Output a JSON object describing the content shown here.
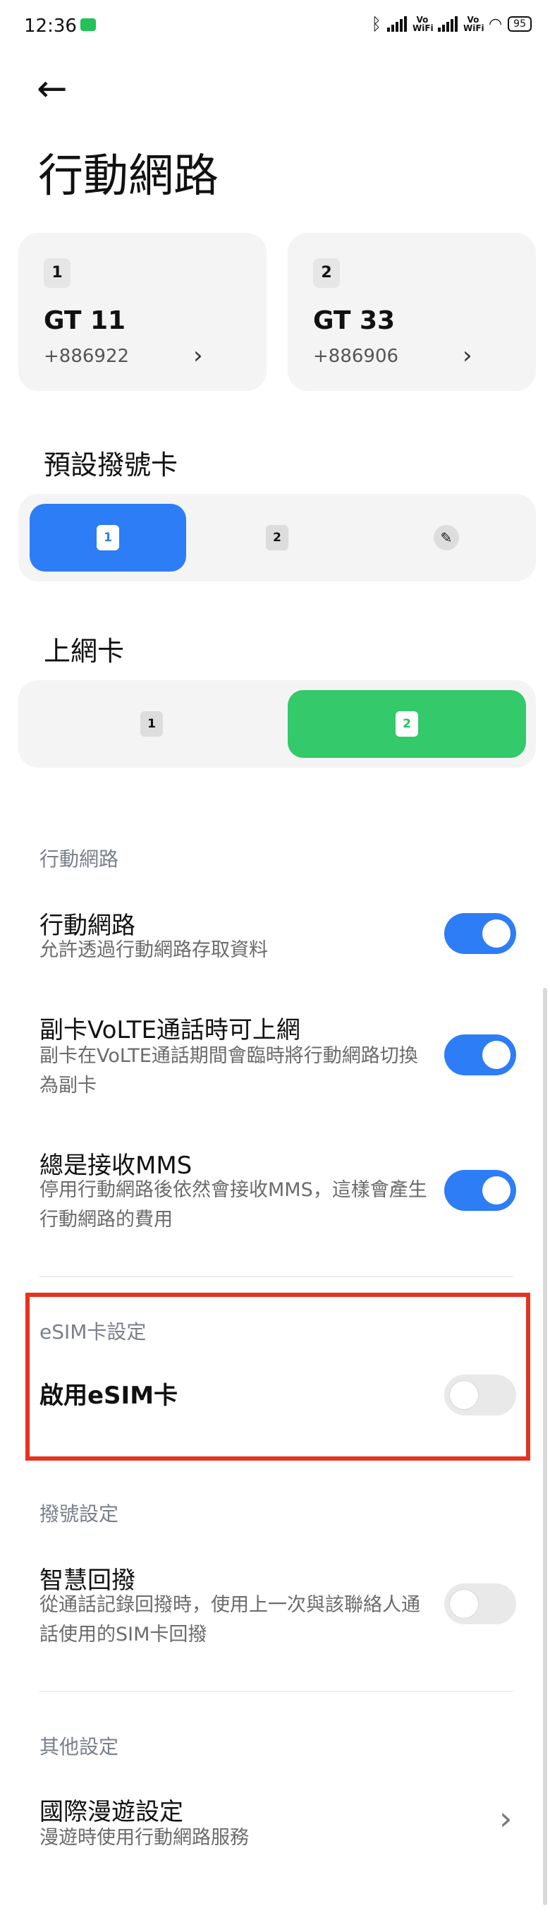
{
  "status_bar": {
    "time": "12:36",
    "vowifi_1": "Vo WiFi",
    "vowifi_2": "Vo WiFi",
    "battery": "95"
  },
  "header": {
    "title": "行動網路"
  },
  "sim_cards": [
    {
      "slot": "1",
      "name": "GT 11",
      "number": "+886922"
    },
    {
      "slot": "2",
      "name": "GT 33",
      "number": "+886906"
    }
  ],
  "default_call_sim": {
    "label": "預設撥號卡",
    "options": [
      "1",
      "2"
    ],
    "selected": "1",
    "accent": "#2d7df6"
  },
  "data_sim": {
    "label": "上網卡",
    "options": [
      "1",
      "2"
    ],
    "selected": "2",
    "accent": "#34c96a"
  },
  "mobile_network_section": {
    "category": "行動網路",
    "items": [
      {
        "title": "行動網路",
        "subtitle": "允許透過行動網路存取資料",
        "enabled": true
      },
      {
        "title": "副卡VoLTE通話時可上網",
        "subtitle": "副卡在VoLTE通話期間會臨時將行動網路切換為副卡",
        "enabled": true
      },
      {
        "title": "總是接收MMS",
        "subtitle": "停用行動網路後依然會接收MMS，這樣會產生行動網路的費用",
        "enabled": true
      }
    ]
  },
  "esim_section": {
    "category": "eSIM卡設定",
    "item_title": "啟用eSIM卡",
    "enabled": false,
    "highlight_color": "#e7321f"
  },
  "dial_section": {
    "category": "撥號設定",
    "item_title": "智慧回撥",
    "item_subtitle": "從通話記錄回撥時，使用上一次與該聯絡人通話使用的SIM卡回撥",
    "enabled": false
  },
  "other_section": {
    "category": "其他設定",
    "item_title": "國際漫遊設定",
    "item_subtitle": "漫遊時使用行動網路服務"
  },
  "icons": [
    "back-arrow-icon",
    "chevron-right-icon",
    "pencil-icon",
    "bluetooth-icon",
    "signal-icon",
    "wifi-icon",
    "battery-icon",
    "chat-notification-icon"
  ]
}
